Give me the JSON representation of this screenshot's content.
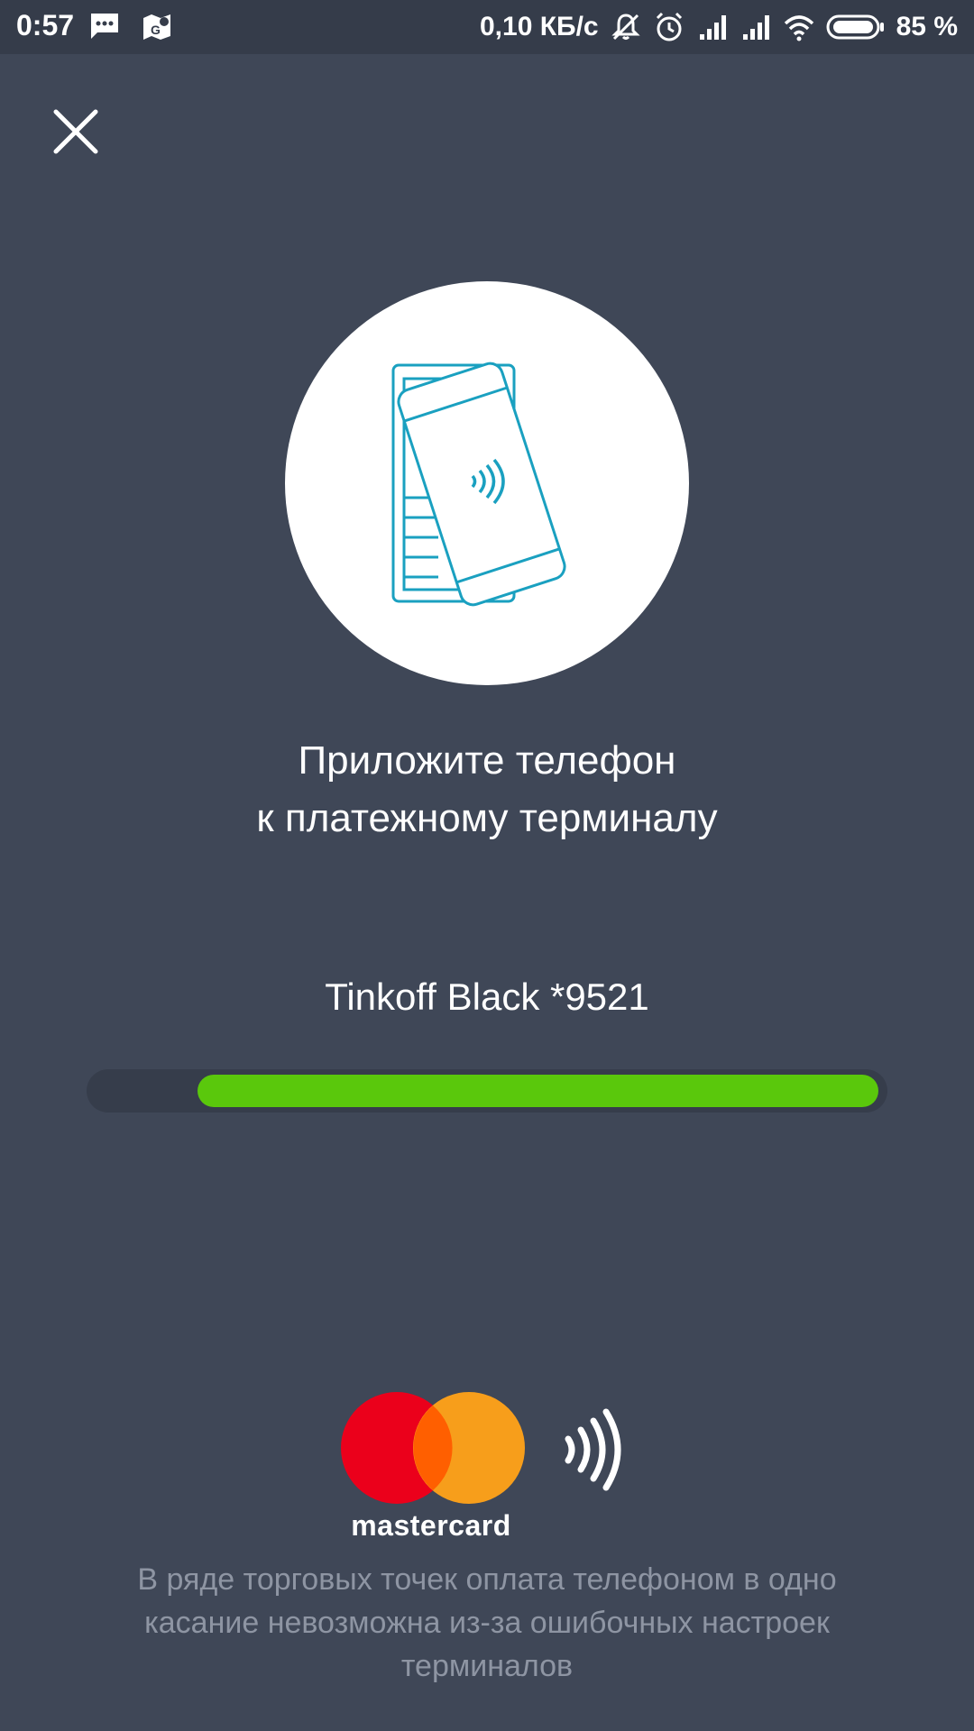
{
  "status_bar": {
    "time": "0:57",
    "left_icons": [
      "message-icon",
      "maps-icon"
    ],
    "network_speed": "0,10 КБ/с",
    "right_icons": [
      "mute-icon",
      "alarm-icon",
      "signal-icon",
      "signal-icon",
      "wifi-icon",
      "battery-icon"
    ],
    "battery_percent": "85 %"
  },
  "close": {
    "icon": "close-icon"
  },
  "illustration": {
    "icon": "phone-on-terminal-icon",
    "accent_color": "#1aa0c0"
  },
  "headline": {
    "line1": "Приложите телефон",
    "line2": "к платежному терминалу"
  },
  "card": {
    "name": "Tinkoff Black *9521"
  },
  "progress": {
    "fraction_remaining": 0.87,
    "color": "#5ac80c"
  },
  "payment_system": {
    "brand": "mastercard",
    "colors": {
      "red": "#eb001b",
      "orange": "#f79e1b",
      "overlap": "#ff5f00"
    },
    "contactless_icon": "contactless-icon"
  },
  "disclaimer": "В ряде торговых точек оплата телефоном в одно касание невозможна из-за ошибочных настроек терминалов"
}
